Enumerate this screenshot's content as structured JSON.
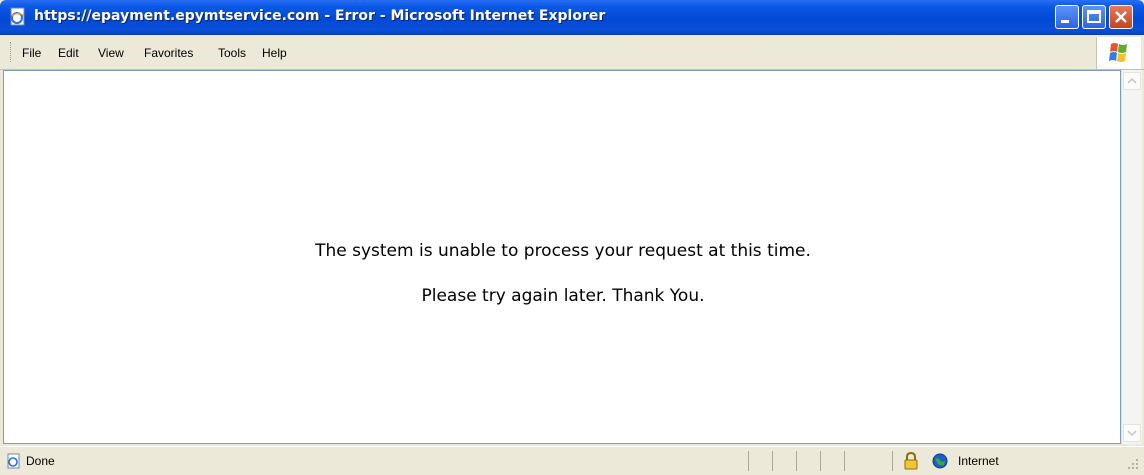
{
  "window": {
    "title": "https://epayment.epymtservice.com - Error - Microsoft Internet Explorer"
  },
  "menu": {
    "items": [
      "File",
      "Edit",
      "View",
      "Favorites",
      "Tools",
      "Help"
    ]
  },
  "page": {
    "message_line1": "The system is unable to process your request at this time.",
    "message_line2": "Please try again later. Thank You."
  },
  "statusbar": {
    "status": "Done",
    "zone": "Internet"
  },
  "icons": {
    "title": "ie-page-icon",
    "status": "ie-page-icon",
    "security": "lock-icon",
    "zone": "globe-icon"
  },
  "colors": {
    "titlebar": "#0a59e6",
    "chrome": "#ece9d8",
    "close_button": "#c7411b"
  }
}
